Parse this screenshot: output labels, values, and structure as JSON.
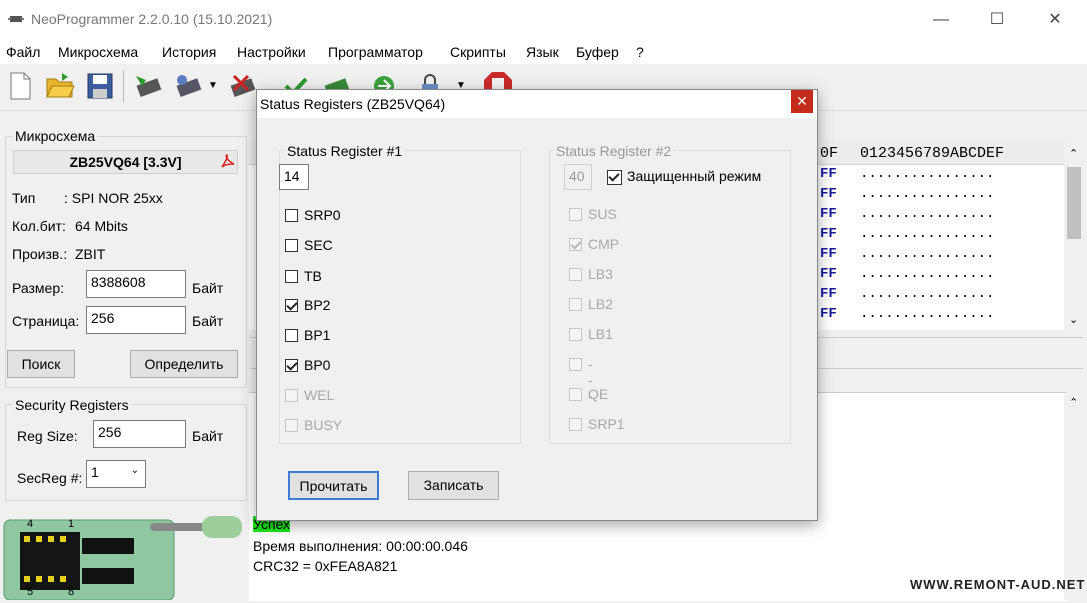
{
  "window": {
    "title": "NeoProgrammer 2.2.0.10 (15.10.2021)",
    "min": "—",
    "max": "☐",
    "close": "✕"
  },
  "menu": [
    "Файл",
    "Микросхема",
    "История",
    "Настройки",
    "Программатор",
    "Скрипты",
    "Язык",
    "Буфер",
    "?"
  ],
  "chip_panel": {
    "group_title": "Микросхема",
    "chip_name": "ZB25VQ64 [3.3V]",
    "type_label": "Тип",
    "type_value": ": SPI NOR 25xx",
    "bits_label": "Кол.бит:",
    "bits_value": "64 Mbits",
    "vendor_label": "Произв.:",
    "vendor_value": "ZBIT",
    "size_label": "Размер:",
    "size_value": "8388608",
    "size_unit": "Байт",
    "page_label": "Страница:",
    "page_value": "256",
    "page_unit": "Байт",
    "search_button": "Поиск",
    "detect_button": "Определить"
  },
  "security": {
    "group_title": "Security Registers",
    "regsize_label": "Reg Size:",
    "regsize_value": "256",
    "regsize_unit": "Байт",
    "secreg_label": "SecReg #:",
    "secreg_value": "1"
  },
  "socket": {
    "pin_top_left": "4",
    "pin_top_right": "1",
    "pin_bottom_left": "5",
    "pin_bottom_right": "8"
  },
  "hex": {
    "header_addr": "0F",
    "header_ascii": "0123456789ABCDEF",
    "rows": [
      {
        "v": "FF",
        "a": "................"
      },
      {
        "v": "FF",
        "a": "................"
      },
      {
        "v": "FF",
        "a": "................"
      },
      {
        "v": "FF",
        "a": "................"
      },
      {
        "v": "FF",
        "a": "................"
      },
      {
        "v": "FF",
        "a": "................"
      },
      {
        "v": "FF",
        "a": "................"
      },
      {
        "v": "FF",
        "a": "................"
      }
    ]
  },
  "log": {
    "success": "Успех",
    "time": "Время выполнения: 00:00:00.046",
    "crc": "CRC32 = 0xFEA8A821"
  },
  "dialog": {
    "title": "Status Registers (ZB25VQ64)",
    "close": "✕",
    "sr1": {
      "title": "Status Register #1",
      "value": "14",
      "bits": [
        {
          "name": "SRP0",
          "checked": false,
          "disabled": false
        },
        {
          "name": "SEC",
          "checked": false,
          "disabled": false
        },
        {
          "name": "TB",
          "checked": false,
          "disabled": false
        },
        {
          "name": "BP2",
          "checked": true,
          "disabled": false
        },
        {
          "name": "BP1",
          "checked": false,
          "disabled": false
        },
        {
          "name": "BP0",
          "checked": true,
          "disabled": false
        },
        {
          "name": "WEL",
          "checked": false,
          "disabled": true
        },
        {
          "name": "BUSY",
          "checked": false,
          "disabled": true
        }
      ]
    },
    "sr2": {
      "title": "Status Register #2",
      "value": "40",
      "protected_label": "Защищенный режим",
      "protected_checked": true,
      "bits": [
        {
          "name": "SUS",
          "checked": false,
          "disabled": true
        },
        {
          "name": "CMP",
          "checked": true,
          "disabled": true
        },
        {
          "name": "LB3",
          "checked": false,
          "disabled": true
        },
        {
          "name": "LB2",
          "checked": false,
          "disabled": true
        },
        {
          "name": "LB1",
          "checked": false,
          "disabled": true
        },
        {
          "name": "---",
          "checked": false,
          "disabled": true
        },
        {
          "name": "QE",
          "checked": false,
          "disabled": true
        },
        {
          "name": "SRP1",
          "checked": false,
          "disabled": true
        }
      ]
    },
    "read_button": "Прочитать",
    "write_button": "Записать"
  },
  "watermark": "WWW.REMONT-AUD.NET"
}
